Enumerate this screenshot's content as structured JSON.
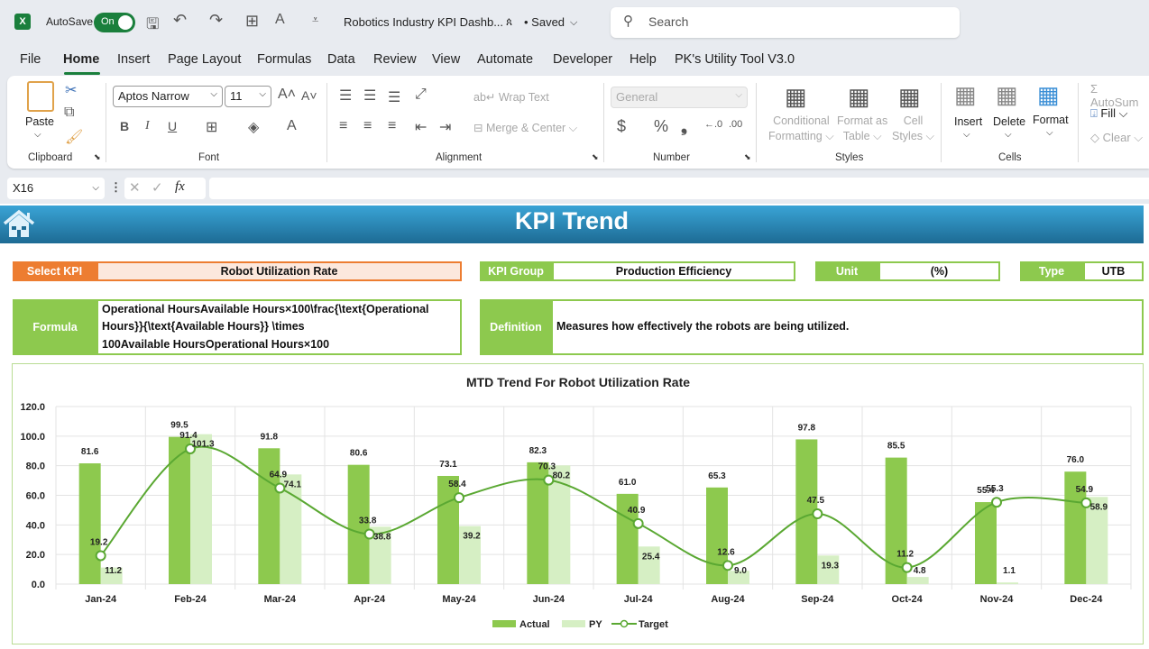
{
  "app": {
    "autosave_label": "AutoSave",
    "autosave_state": "On",
    "doc_title": "Robotics Industry KPI Dashb...",
    "save_status": "• Saved",
    "search_placeholder": "Search"
  },
  "menu": [
    "File",
    "Home",
    "Insert",
    "Page Layout",
    "Formulas",
    "Data",
    "Review",
    "View",
    "Automate",
    "Developer",
    "Help",
    "PK's Utility Tool V3.0"
  ],
  "ribbon": {
    "clipboard": {
      "paste": "Paste",
      "group": "Clipboard"
    },
    "font": {
      "name": "Aptos Narrow",
      "size": "11",
      "group": "Font",
      "bold": "B",
      "italic": "I",
      "underline": "U"
    },
    "alignment": {
      "wrap": "Wrap Text",
      "merge": "Merge & Center",
      "group": "Alignment"
    },
    "number": {
      "format": "General",
      "currency": "$",
      "percent": "%",
      "comma": "❟",
      "group": "Number"
    },
    "styles": {
      "conditional": "Conditional",
      "conditional2": "Formatting",
      "format_table": "Format as",
      "format_table2": "Table",
      "cell_styles": "Cell",
      "cell_styles2": "Styles",
      "group": "Styles"
    },
    "cells": {
      "insert": "Insert",
      "delete": "Delete",
      "format": "Format",
      "group": "Cells"
    },
    "editing": {
      "autosum": "AutoSum",
      "fill": "Fill",
      "clear": "Clear"
    }
  },
  "formula_bar": {
    "name_box": "X16",
    "fx": "fx",
    "value": ""
  },
  "dashboard": {
    "title": "KPI Trend",
    "select_kpi_label": "Select KPI",
    "select_kpi_value": "Robot Utilization Rate",
    "kpi_group_label": "KPI Group",
    "kpi_group_value": "Production Efficiency",
    "unit_label": "Unit",
    "unit_value": "(%)",
    "type_label": "Type",
    "type_value": "UTB",
    "formula_label": "Formula",
    "formula_lines": [
      "Operational HoursAvailable Hours×100\\frac{\\text{Operational",
      "Hours}}{\\text{Available Hours}} \\times",
      "100Available HoursOperational Hours×100"
    ],
    "definition_label": "Definition",
    "definition_value": "Measures how effectively the robots are being utilized."
  },
  "colors": {
    "actual": "#8dc94e",
    "py": "#d6efc4",
    "target": "#5aa832",
    "banner_top": "#3aa4d6",
    "banner_bottom": "#1d6b94",
    "kpi_accent": "#ed7d31"
  },
  "chart_data": {
    "type": "bar",
    "title": "MTD Trend For Robot Utilization Rate",
    "xlabel": "",
    "ylabel": "",
    "ylim": [
      0,
      120
    ],
    "yticks": [
      "0.0",
      "20.0",
      "40.0",
      "60.0",
      "80.0",
      "100.0",
      "120.0"
    ],
    "grid": true,
    "legend": "bottom",
    "categories": [
      "Jan-24",
      "Feb-24",
      "Mar-24",
      "Apr-24",
      "May-24",
      "Jun-24",
      "Jul-24",
      "Aug-24",
      "Sep-24",
      "Oct-24",
      "Nov-24",
      "Dec-24"
    ],
    "series": [
      {
        "name": "Actual",
        "type": "bar",
        "values": [
          81.6,
          99.5,
          91.8,
          80.6,
          73.1,
          82.3,
          61.0,
          65.3,
          97.8,
          85.5,
          55.4,
          76.0
        ]
      },
      {
        "name": "PY",
        "type": "bar",
        "values": [
          11.2,
          101.3,
          74.1,
          38.8,
          39.2,
          80.2,
          25.4,
          9.0,
          19.3,
          4.8,
          1.1,
          58.9
        ]
      },
      {
        "name": "Target",
        "type": "line",
        "values": [
          19.2,
          91.4,
          64.9,
          33.8,
          58.4,
          70.3,
          40.9,
          12.6,
          47.5,
          11.2,
          55.3,
          54.9
        ]
      }
    ]
  }
}
